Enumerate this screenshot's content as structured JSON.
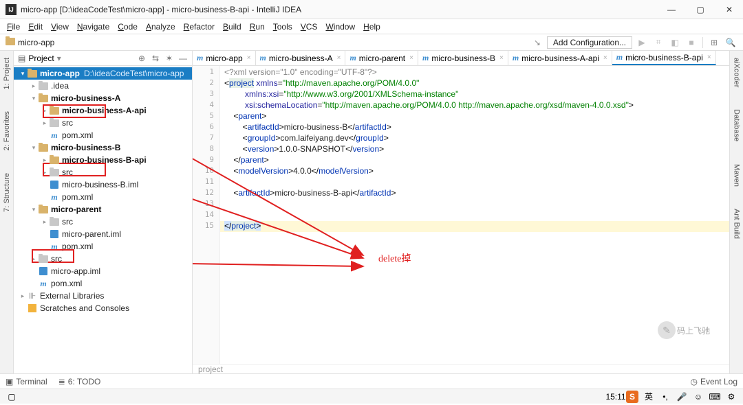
{
  "title": "micro-app [D:\\ideaCodeTest\\micro-app] - micro-business-B-api - IntelliJ IDEA",
  "menu": [
    "File",
    "Edit",
    "View",
    "Navigate",
    "Code",
    "Analyze",
    "Refactor",
    "Build",
    "Run",
    "Tools",
    "VCS",
    "Window",
    "Help"
  ],
  "breadcrumb": "micro-app",
  "addConfig": "Add Configuration...",
  "leftTabs": [
    "1: Project",
    "2: Favorites",
    "7: Structure"
  ],
  "rightTabs": [
    "aiXcoder",
    "Database",
    "Maven",
    "Ant Build"
  ],
  "projectHeader": "Project",
  "tree": [
    {
      "d": 0,
      "a": "▾",
      "i": "fld",
      "n": "micro-app",
      "sub": "D:\\ideaCodeTest\\micro-app",
      "b": true,
      "sel": true
    },
    {
      "d": 1,
      "a": "▸",
      "i": "fld-g",
      "n": ".idea"
    },
    {
      "d": 1,
      "a": "▾",
      "i": "fld",
      "n": "micro-business-A",
      "b": true
    },
    {
      "d": 2,
      "a": "▸",
      "i": "fld",
      "n": "micro-business-A-api",
      "b": true
    },
    {
      "d": 2,
      "a": "▸",
      "i": "fld-g",
      "n": "src"
    },
    {
      "d": 2,
      "a": "",
      "i": "m",
      "n": "pom.xml"
    },
    {
      "d": 1,
      "a": "▾",
      "i": "fld",
      "n": "micro-business-B",
      "b": true
    },
    {
      "d": 2,
      "a": "▸",
      "i": "fld",
      "n": "micro-business-B-api",
      "b": true
    },
    {
      "d": 2,
      "a": "▸",
      "i": "fld-g",
      "n": "src"
    },
    {
      "d": 2,
      "a": "",
      "i": "iml",
      "n": "micro-business-B.iml"
    },
    {
      "d": 2,
      "a": "",
      "i": "m",
      "n": "pom.xml"
    },
    {
      "d": 1,
      "a": "▾",
      "i": "fld",
      "n": "micro-parent",
      "b": true
    },
    {
      "d": 2,
      "a": "▸",
      "i": "fld-g",
      "n": "src"
    },
    {
      "d": 2,
      "a": "",
      "i": "iml",
      "n": "micro-parent.iml"
    },
    {
      "d": 2,
      "a": "",
      "i": "m",
      "n": "pom.xml"
    },
    {
      "d": 1,
      "a": "▸",
      "i": "fld-g",
      "n": "src"
    },
    {
      "d": 1,
      "a": "",
      "i": "iml",
      "n": "micro-app.iml"
    },
    {
      "d": 1,
      "a": "",
      "i": "m",
      "n": "pom.xml"
    },
    {
      "d": 0,
      "a": "▸",
      "i": "lib",
      "n": "External Libraries"
    },
    {
      "d": 0,
      "a": "",
      "i": "box",
      "n": "Scratches and Consoles"
    }
  ],
  "editorTabs": [
    {
      "n": "micro-app",
      "a": false
    },
    {
      "n": "micro-business-A",
      "a": false
    },
    {
      "n": "micro-parent",
      "a": false
    },
    {
      "n": "micro-business-B",
      "a": false
    },
    {
      "n": "micro-business-A-api",
      "a": false
    },
    {
      "n": "micro-business-B-api",
      "a": true
    }
  ],
  "gutter": [
    "1",
    "2",
    "3",
    "4",
    "5",
    "6",
    "7",
    "8",
    "9",
    "10",
    "11",
    "12",
    "13",
    "14",
    "15"
  ],
  "code": [
    {
      "t": "decl",
      "c": "<?xml version=\"1.0\" encoding=\"UTF-8\"?>"
    },
    {
      "t": "proj-open",
      "pre": "<",
      "tag": "project",
      "xmlns": "http://maven.apache.org/POM/4.0.0"
    },
    {
      "t": "attr-line",
      "ind": "         ",
      "attr": "xmlns:xsi",
      "val": "http://www.w3.org/2001/XMLSchema-instance"
    },
    {
      "t": "attr-close",
      "ind": "         ",
      "attr": "xsi:schemaLocation",
      "val": "http://maven.apache.org/POM/4.0.0 http://maven.apache.org/xsd/maven-4.0.0.xsd"
    },
    {
      "t": "open",
      "ind": "    ",
      "tag": "parent"
    },
    {
      "t": "leaf",
      "ind": "        ",
      "tag": "artifactId",
      "txt": "micro-business-B"
    },
    {
      "t": "leaf",
      "ind": "        ",
      "tag": "groupId",
      "txt": "com.laifeiyang.dev"
    },
    {
      "t": "leaf",
      "ind": "        ",
      "tag": "version",
      "txt": "1.0.0-SNAPSHOT"
    },
    {
      "t": "close",
      "ind": "    ",
      "tag": "parent"
    },
    {
      "t": "leaf",
      "ind": "    ",
      "tag": "modelVersion",
      "txt": "4.0.0"
    },
    {
      "t": "blank"
    },
    {
      "t": "leaf",
      "ind": "    ",
      "tag": "artifactId",
      "txt": "micro-business-B-api"
    },
    {
      "t": "blank"
    },
    {
      "t": "blank"
    },
    {
      "t": "endproj",
      "tag": "project",
      "hl": true
    }
  ],
  "crumb2": "project",
  "annot": "delete掉",
  "status": {
    "terminal": "Terminal",
    "todo": "6: TODO",
    "eventlog": "Event Log"
  },
  "bottom": {
    "time": "15:11"
  },
  "wm": "码上飞驰"
}
